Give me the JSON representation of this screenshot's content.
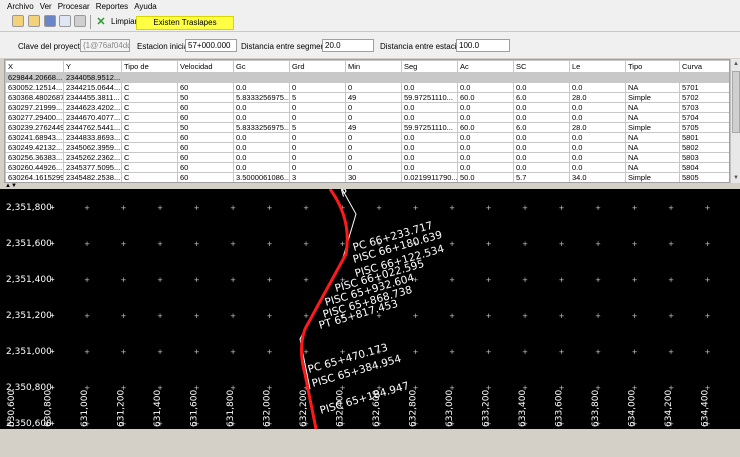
{
  "menu": [
    "Archivo",
    "Ver",
    "Procesar",
    "Reportes",
    "Ayuda"
  ],
  "toolbar": {
    "icons": [
      "open-icon",
      "open-folder-icon",
      "save-icon",
      "export-icon",
      "print-icon"
    ],
    "clear_label": "Limpiar",
    "warning_label": "Existen Traslapes"
  },
  "params": {
    "project_key_label": "Clave del proyecto:",
    "project_key_value": "{1@76af04dd",
    "start_station_label": "Estacion inicial:",
    "start_station_value": "57+000.000",
    "segment_distance_label": "Distancia entre segmentos",
    "segment_distance_value": "20.0",
    "station_distance_label": "Distancia entre estacion:",
    "station_distance_value": "100.0"
  },
  "table": {
    "columns": [
      "X",
      "Y",
      "Tipo de",
      "Velocidad",
      "Gc",
      "Grd",
      "Min",
      "Seg",
      "Ac",
      "SC",
      "Le",
      "Tipo",
      "Curva"
    ],
    "rows": [
      [
        "629844.20668...",
        "2344058.9512...",
        "",
        "",
        "",
        "",
        "",
        "",
        "",
        "",
        "",
        "",
        ""
      ],
      [
        "630052.12514...",
        "2344215.0644...",
        "C",
        "60",
        "0.0",
        "0",
        "0",
        "0.0",
        "0.0",
        "0.0",
        "0.0",
        "NA",
        "5701"
      ],
      [
        "630368.4802687",
        "2344455.3811...",
        "C",
        "50",
        "5.8333256975...",
        "5",
        "49",
        "59.97251110...",
        "60.0",
        "6.0",
        "28.0",
        "Simple",
        "5702"
      ],
      [
        "630297.21999...",
        "2344623.4202...",
        "C",
        "60",
        "0.0",
        "0",
        "0",
        "0.0",
        "0.0",
        "0.0",
        "0.0",
        "NA",
        "5703"
      ],
      [
        "630277.29400...",
        "2344670.4077...",
        "C",
        "60",
        "0.0",
        "0",
        "0",
        "0.0",
        "0.0",
        "0.0",
        "0.0",
        "NA",
        "5704"
      ],
      [
        "630239.2762449",
        "2344762.5441...",
        "C",
        "50",
        "5.8333256975...",
        "5",
        "49",
        "59.97251110...",
        "60.0",
        "6.0",
        "28.0",
        "Simple",
        "5705"
      ],
      [
        "630241.68943...",
        "2344833.8693...",
        "C",
        "60",
        "0.0",
        "0",
        "0",
        "0.0",
        "0.0",
        "0.0",
        "0.0",
        "NA",
        "5801"
      ],
      [
        "630249.42132...",
        "2345062.3959...",
        "C",
        "60",
        "0.0",
        "0",
        "0",
        "0.0",
        "0.0",
        "0.0",
        "0.0",
        "NA",
        "5802"
      ],
      [
        "630256.36383...",
        "2345262.2362...",
        "C",
        "60",
        "0.0",
        "0",
        "0",
        "0.0",
        "0.0",
        "0.0",
        "0.0",
        "NA",
        "5803"
      ],
      [
        "630260.44926...",
        "2345377.5095...",
        "C",
        "60",
        "0.0",
        "0",
        "0",
        "0.0",
        "0.0",
        "0.0",
        "0.0",
        "NA",
        "5804"
      ],
      [
        "630264.1615299",
        "2345482.2538...",
        "C",
        "60",
        "3.5000061086...",
        "3",
        "30",
        "0.0219911790...",
        "50.0",
        "5.7",
        "34.0",
        "Simple",
        "5805"
      ]
    ]
  },
  "plot": {
    "y_ticks": [
      "2,351,800",
      "2,351,600",
      "2,351,400",
      "2,351,200",
      "2,351,000",
      "2,350,800",
      "2,350,600"
    ],
    "x_ticks": [
      "630,600",
      "630,800",
      "631,000",
      "631,200",
      "631,400",
      "631,600",
      "631,800",
      "632,000",
      "632,200",
      "632,400",
      "632,600",
      "632,800",
      "633,000",
      "633,200",
      "633,400",
      "633,600",
      "633,800",
      "634,000",
      "634,200",
      "634,400"
    ],
    "station_labels": [
      "PC 66+233.717",
      "PISC 66+180.639",
      "PISC 66+122.534",
      "PISC 66+022.595",
      "PISC 65+932.604",
      "PISC 65+868.738",
      "PT 65+817.453",
      "PC 65+470.173",
      "PISC 65+384.954",
      "PISC 65+184.947",
      "P"
    ],
    "colors": {
      "background": "#000000",
      "alignment": "#ff1a1a",
      "tangent": "#ffffff",
      "text": "#ffffff"
    }
  }
}
